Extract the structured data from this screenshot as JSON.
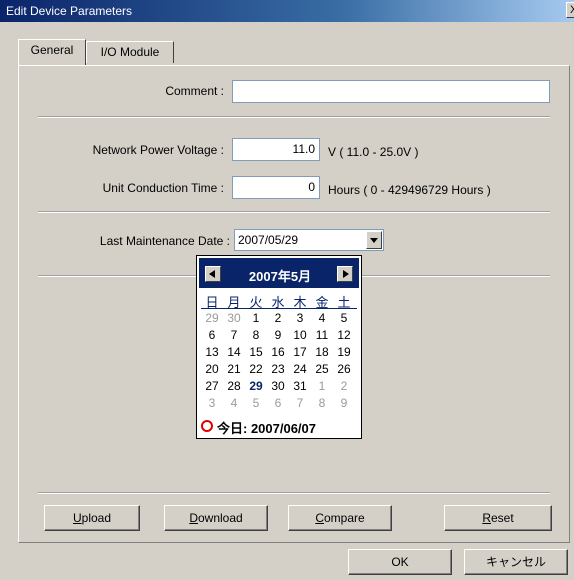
{
  "window": {
    "title": "Edit Device Parameters",
    "close_glyph": "X"
  },
  "tabs": [
    {
      "label": "General"
    },
    {
      "label": "I/O Module"
    }
  ],
  "fields": {
    "comment": {
      "label": "Comment :",
      "value": ""
    },
    "voltage": {
      "label": "Network Power Voltage :",
      "value": "11.0",
      "unit": "V ( 11.0 - 25.0V )"
    },
    "conduction": {
      "label": "Unit Conduction Time :",
      "value": "0",
      "unit": "Hours ( 0 - 429496729 Hours )"
    },
    "maintenance": {
      "label": "Last Maintenance Date :",
      "value": "2007/05/29"
    }
  },
  "calendar": {
    "month_label": "2007年5月",
    "dows": [
      "日",
      "月",
      "火",
      "水",
      "木",
      "金",
      "土"
    ],
    "weeks": [
      [
        "29",
        "30",
        "1",
        "2",
        "3",
        "4",
        "5"
      ],
      [
        "6",
        "7",
        "8",
        "9",
        "10",
        "11",
        "12"
      ],
      [
        "13",
        "14",
        "15",
        "16",
        "17",
        "18",
        "19"
      ],
      [
        "20",
        "21",
        "22",
        "23",
        "24",
        "25",
        "26"
      ],
      [
        "27",
        "28",
        "29",
        "30",
        "31",
        "1",
        "2"
      ],
      [
        "3",
        "4",
        "5",
        "6",
        "7",
        "8",
        "9"
      ]
    ],
    "today_label": "今日: 2007/06/07"
  },
  "buttons": {
    "upload": {
      "underline": "U",
      "rest": "pload"
    },
    "download": {
      "underline": "D",
      "rest": "ownload"
    },
    "compare": {
      "underline": "C",
      "rest": "ompare"
    },
    "reset": {
      "underline": "R",
      "rest": "eset"
    },
    "ok": "OK",
    "cancel": "キャンセル"
  }
}
